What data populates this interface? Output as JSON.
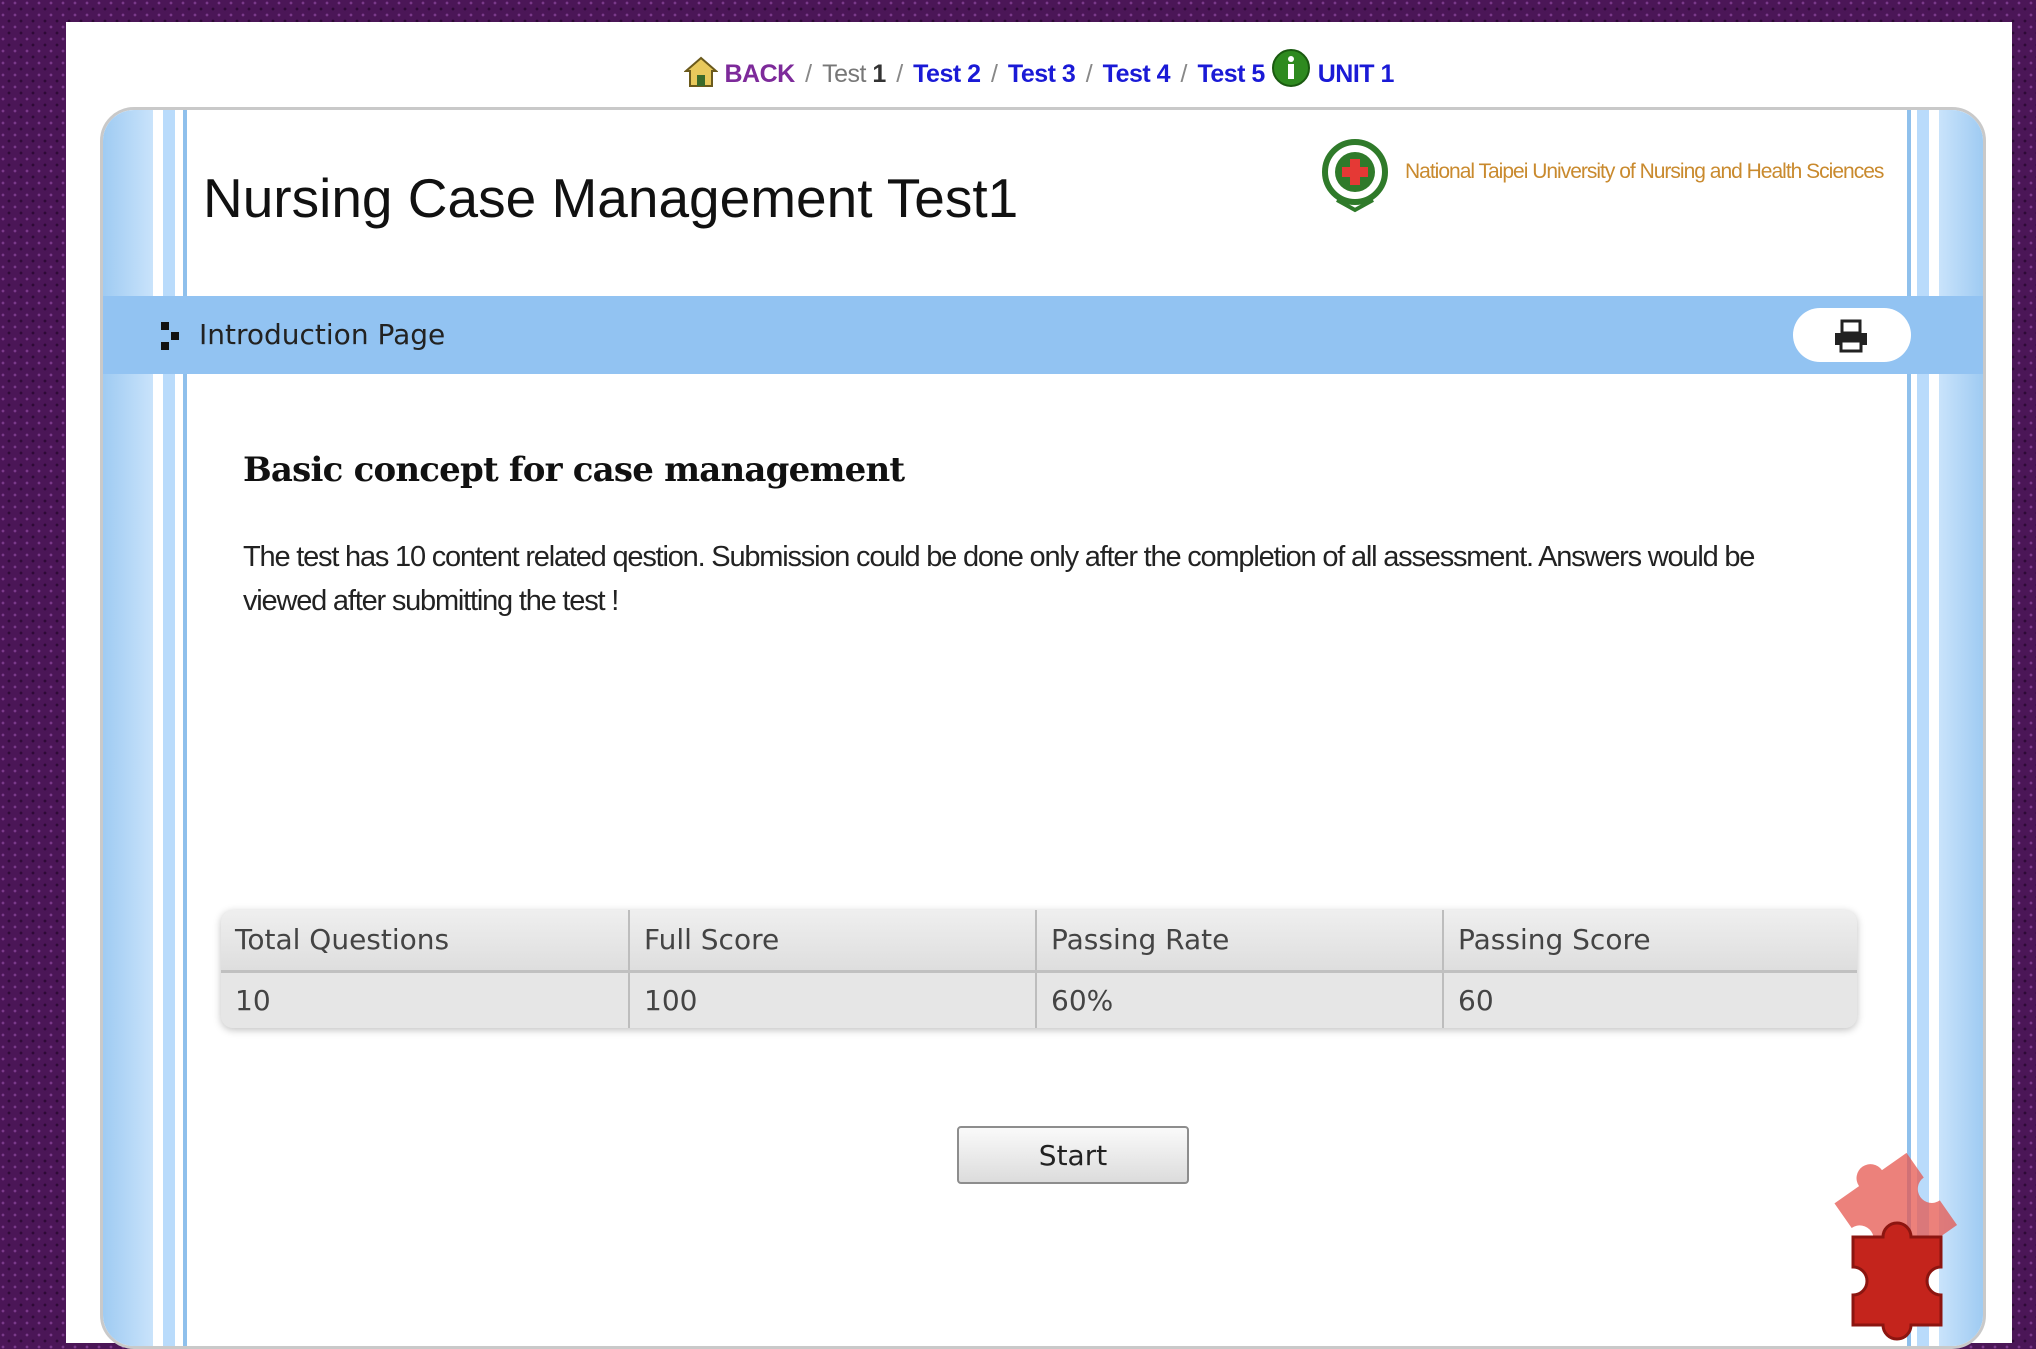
{
  "nav": {
    "back_label": "BACK",
    "separator": "/",
    "current_prefix": "Test ",
    "current_number": "1",
    "test2": "Test 2",
    "test3": "Test 3",
    "test4": "Test 4",
    "test5": "Test 5",
    "unit_label": "UNIT 1"
  },
  "header": {
    "title": "Nursing Case Management Test1",
    "university": "National Taipei University of Nursing and Health Sciences"
  },
  "section": {
    "label": "Introduction Page",
    "print_icon": "printer-icon"
  },
  "content": {
    "heading": "Basic concept for case management",
    "description": "The test has 10 content related qestion. Submission could be done only after the completion of all assessment. Answers would be viewed after submitting the test !"
  },
  "stats": {
    "headers": [
      "Total Questions",
      "Full Score",
      "Passing Rate",
      "Passing Score"
    ],
    "values": [
      "10",
      "100",
      "60%",
      "60"
    ]
  },
  "start_label": "Start",
  "colors": {
    "background": "#4b1657",
    "section_bar": "#92c3f2",
    "link": "#1a1ad6",
    "back_link": "#7d2a9a",
    "university_text": "#c98a2e"
  }
}
